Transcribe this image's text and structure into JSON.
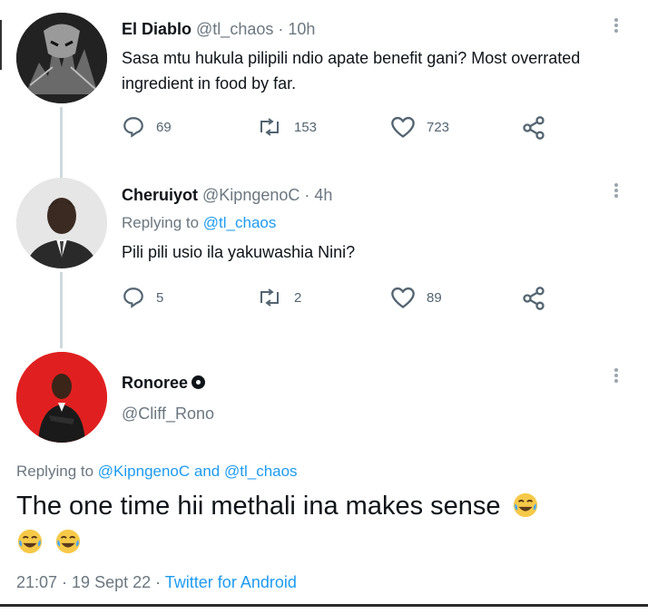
{
  "tweet1": {
    "name": "El Diablo",
    "handle": "@tl_chaos",
    "time": "· 10h",
    "text": "Sasa mtu hukula pilipili ndio apate benefit gani? Most overrated ingredient in food by far.",
    "replies": "69",
    "retweets": "153",
    "likes": "723"
  },
  "tweet2": {
    "name": "Cheruiyot",
    "handle": "@KipngenoC",
    "time": "· 4h",
    "replying_prefix": "Replying to ",
    "replying_to": "@tl_chaos",
    "text": "Pili pili usio ila yakuwashia Nini?",
    "replies": "5",
    "retweets": "2",
    "likes": "89"
  },
  "tweet3": {
    "name": "Ronoree",
    "handle": "@Cliff_Rono",
    "replying_prefix": "Replying to ",
    "replying_user1": "@KipngenoC",
    "replying_and": " and ",
    "replying_user2": "@tl_chaos",
    "text": "The one time hii methali ina makes sense",
    "timestamp": "21:07 · 19 Sept 22 · ",
    "source": "Twitter for Android"
  },
  "colors": {
    "link": "#1d9bf0",
    "muted": "#6b7780",
    "thread_line": "#cfd9de",
    "avatar_red": "#e02020"
  }
}
